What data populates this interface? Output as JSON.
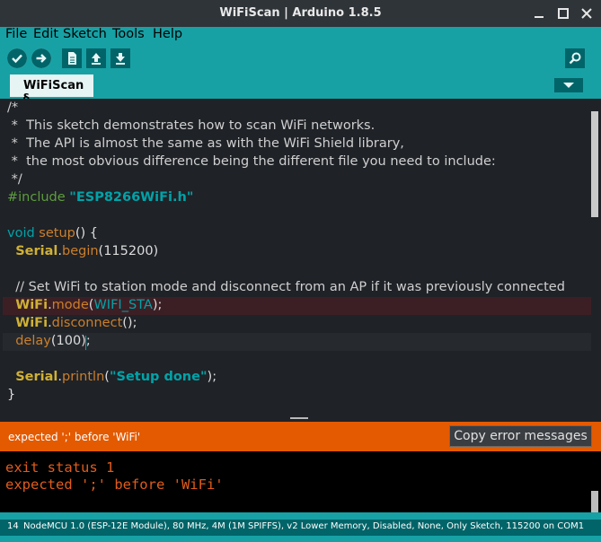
{
  "window": {
    "title": "WiFiScan | Arduino 1.8.5",
    "minimize_glyph": "✕",
    "close_glyph": "✕",
    "colors": {
      "accent": "#17a1a5",
      "error": "#e35a00",
      "editor_bg": "#1f2227",
      "status_strip": "#006468"
    }
  },
  "menu": {
    "file": "File",
    "edit": "Edit",
    "sketch": "Sketch",
    "tools": "Tools",
    "help": "Help"
  },
  "toolbar": {
    "verify_icon": "checkmark-icon",
    "upload_icon": "arrow-right-icon",
    "new_icon": "document-icon",
    "open_icon": "arrow-up-icon",
    "save_icon": "arrow-down-icon",
    "serial_monitor_icon": "magnifier-icon"
  },
  "tabs": {
    "active": "WiFiScan §",
    "dropdown_icon": "triangle-down-icon"
  },
  "editor": {
    "l1": "/*",
    "l2": " *  This sketch demonstrates how to scan WiFi networks.",
    "l3": " *  The API is almost the same as with the WiFi Shield library,",
    "l4": " *  the most obvious difference being the different file you need to include:",
    "l5": " */",
    "l6_pp": "#include ",
    "l6_str": "\"ESP8266WiFi.h\"",
    "l8_kw": "void ",
    "l8_fn": "setup",
    "l8_rest": "() {",
    "l9_obj": "Serial",
    "l9_dot": ".",
    "l9_fn": "begin",
    "l9_rest": "(115200)",
    "l11": "  // Set WiFi to station mode and disconnect from an AP if it was previously connected",
    "l12_obj": "WiFi",
    "l12_dot": ".",
    "l12_fn": "mode",
    "l12_p1": "(",
    "l12_cst": "WIFI_STA",
    "l12_p2": ");",
    "l13_obj": "WiFi",
    "l13_dot": ".",
    "l13_fn": "disconnect",
    "l13_rest": "();",
    "l14_fn": "delay",
    "l14_rest": "(100);",
    "l16_obj": "Serial",
    "l16_dot": ".",
    "l16_fn": "println",
    "l16_p1": "(",
    "l16_str": "\"Setup done\"",
    "l16_p2": ");",
    "l17": "}"
  },
  "errorbar": {
    "message": "expected ';' before 'WiFi'",
    "copy_button": "Copy error messages"
  },
  "console": {
    "line1": "exit status 1",
    "line2": "expected ';' before 'WiFi'"
  },
  "status": {
    "line_number": "14",
    "board": "NodeMCU 1.0 (ESP-12E Module), 80 MHz, 4M (1M SPIFFS), v2 Lower Memory, Disabled, None, Only Sketch, 115200 on COM1"
  }
}
